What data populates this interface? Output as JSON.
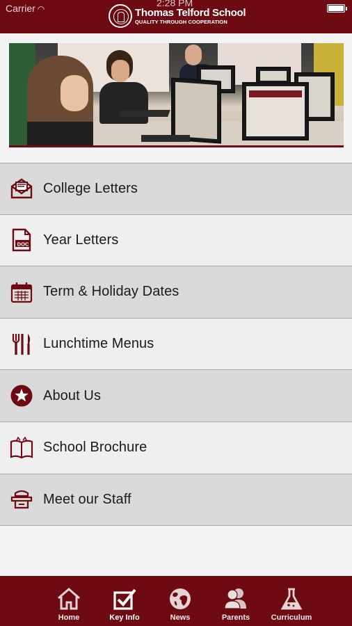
{
  "status_bar": {
    "carrier": "Carrier",
    "time": "2:28 PM"
  },
  "header": {
    "school_name": "Thomas Telford School",
    "tagline": "QUALITY THROUGH COOPERATION"
  },
  "menu": {
    "items": [
      {
        "label": "College Letters",
        "icon": "envelope-icon"
      },
      {
        "label": "Year Letters",
        "icon": "doc-file-icon"
      },
      {
        "label": "Term & Holiday Dates",
        "icon": "calendar-icon"
      },
      {
        "label": "Lunchtime Menus",
        "icon": "cutlery-icon"
      },
      {
        "label": "About Us",
        "icon": "star-badge-icon"
      },
      {
        "label": "School Brochure",
        "icon": "open-book-icon"
      },
      {
        "label": "Meet our Staff",
        "icon": "staff-desk-icon"
      }
    ]
  },
  "tabbar": {
    "tabs": [
      {
        "label": "Home",
        "icon": "house-icon"
      },
      {
        "label": "Key Info",
        "icon": "checkbox-icon",
        "active": true
      },
      {
        "label": "News",
        "icon": "globe-icon"
      },
      {
        "label": "Parents",
        "icon": "people-icon"
      },
      {
        "label": "Curriculum",
        "icon": "flask-icon"
      }
    ]
  },
  "colors": {
    "brand": "#6d0a12",
    "row_dark": "#dadada",
    "row_light": "#efefef"
  }
}
